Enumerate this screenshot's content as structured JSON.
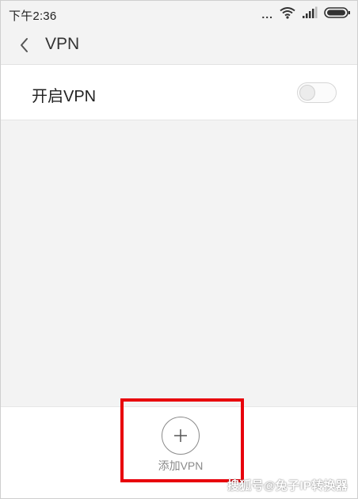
{
  "status_bar": {
    "time": "下午2:36",
    "more_icon": "more-dots",
    "wifi_icon": "wifi-icon",
    "signal_icon": "signal-icon",
    "battery_icon": "battery-icon",
    "more_text": "..."
  },
  "header": {
    "back_icon": "back-arrow-icon",
    "title": "VPN"
  },
  "vpn_toggle": {
    "label": "开启VPN",
    "enabled": false
  },
  "bottom_bar": {
    "add_icon": "plus-icon",
    "add_label": "添加VPN"
  },
  "highlight_color": "#e8000b",
  "watermark": "搜狐号@兔子IP转换器"
}
